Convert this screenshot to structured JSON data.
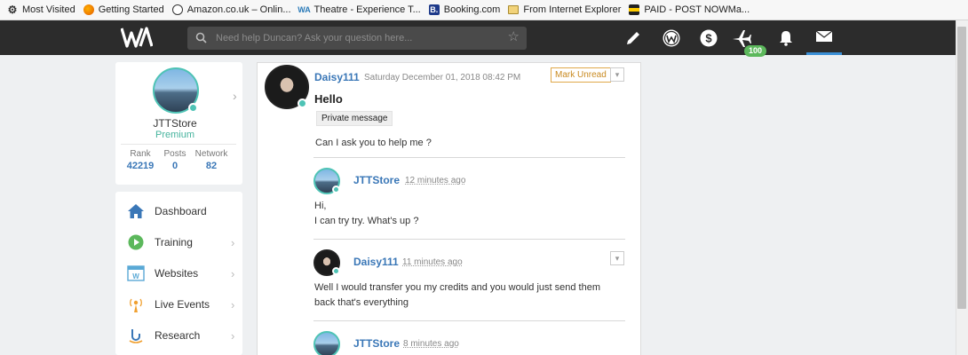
{
  "bookmarks": [
    {
      "icon": "gear-icon",
      "label": "Most Visited"
    },
    {
      "icon": "firefox-icon",
      "label": "Getting Started"
    },
    {
      "icon": "globe-icon",
      "label": "Amazon.co.uk – Onlin..."
    },
    {
      "icon": "wa-icon",
      "label": "Theatre - Experience T..."
    },
    {
      "icon": "booking-icon",
      "label": "Booking.com"
    },
    {
      "icon": "folder-icon",
      "label": "From Internet Explorer"
    },
    {
      "icon": "paid-icon",
      "label": "PAID - POST NOWMa..."
    }
  ],
  "nav": {
    "search_placeholder": "Need help Duncan? Ask your question here...",
    "badge": "100",
    "icons": [
      "pencil-icon",
      "wa-coin-icon",
      "dollar-icon",
      "plane-icon",
      "bell-icon",
      "mail-icon"
    ],
    "active": "mail-icon"
  },
  "profile": {
    "name": "JTTStore",
    "level": "Premium",
    "stats": [
      {
        "label": "Rank",
        "value": "42219"
      },
      {
        "label": "Posts",
        "value": "0"
      },
      {
        "label": "Network",
        "value": "82"
      }
    ]
  },
  "menu": [
    {
      "label": "Dashboard",
      "icon": "home-icon"
    },
    {
      "label": "Training",
      "icon": "play-icon"
    },
    {
      "label": "Websites",
      "icon": "websites-icon"
    },
    {
      "label": "Live Events",
      "icon": "live-events-icon"
    },
    {
      "label": "Research",
      "icon": "research-icon"
    }
  ],
  "thread": {
    "author": "Daisy111",
    "timestamp": "Saturday December 01, 2018 08:42 PM",
    "mark_unread": "Mark Unread",
    "subject": "Hello",
    "tag": "Private message",
    "body": "Can I ask you to help me ?",
    "replies": [
      {
        "author": "JTTStore",
        "time": "12 minutes ago",
        "line1": "Hi,",
        "line2": "I can try try. What's up ?"
      },
      {
        "author": "Daisy111",
        "time": "11 minutes ago",
        "line1": "Well I would transfer you my credits and you would just send them",
        "line2": "back that's everything"
      },
      {
        "author": "JTTStore",
        "time": "8 minutes ago",
        "line1": "",
        "line2": ""
      }
    ]
  },
  "colors": {
    "nav_bg": "#2c2c2c",
    "link_blue": "#3a77b7",
    "premium_green": "#45b39d",
    "badge_green": "#5cb85c",
    "mark_unread_orange": "#c98a20"
  }
}
